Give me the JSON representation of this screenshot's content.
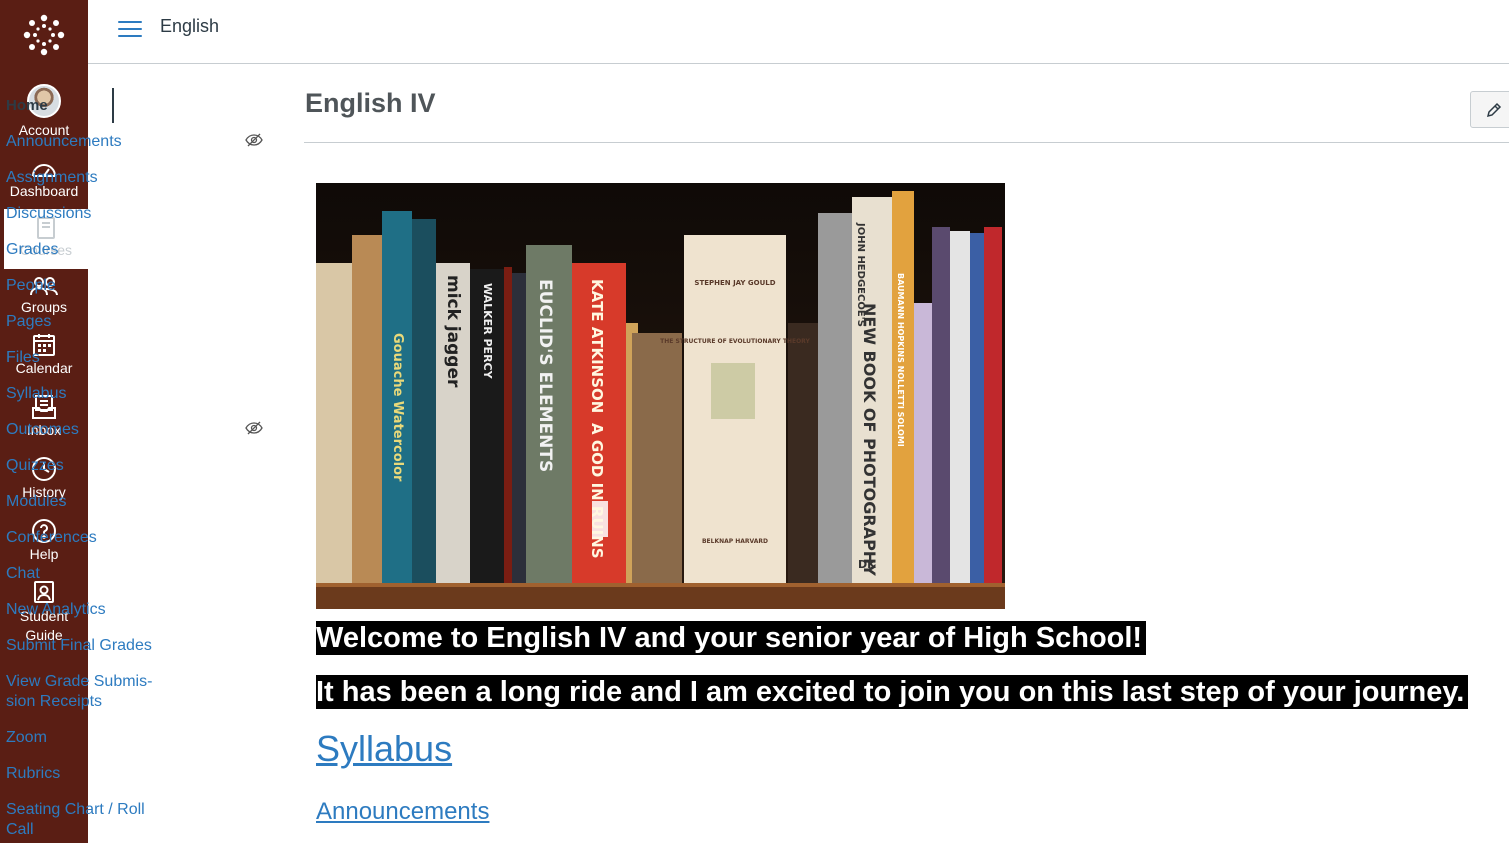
{
  "global_nav": {
    "items": [
      {
        "label": "Account",
        "icon": "avatar"
      },
      {
        "label": "Dashboard",
        "icon": "dashboard-icon"
      },
      {
        "label": "Courses",
        "icon": "courses-icon"
      },
      {
        "label": "Groups",
        "icon": "groups-icon"
      },
      {
        "label": "Calendar",
        "icon": "calendar-icon"
      },
      {
        "label": "Inbox",
        "icon": "inbox-icon"
      },
      {
        "label": "History",
        "icon": "history-icon"
      },
      {
        "label": "Help",
        "icon": "help-icon"
      },
      {
        "label_line1": "Student",
        "label_line2": "Guide",
        "icon": "student-guide-icon"
      }
    ],
    "brand_color": "#5a1e14"
  },
  "header": {
    "breadcrumb": "English"
  },
  "course_nav": {
    "items": [
      {
        "label": "Home",
        "active": true
      },
      {
        "label": "Announcements",
        "hidden_icon": true
      },
      {
        "label": "Assignments"
      },
      {
        "label": "Discussions"
      },
      {
        "label": "Grades"
      },
      {
        "label": "People"
      },
      {
        "label": "Pages"
      },
      {
        "label": "Files"
      },
      {
        "label": "Syllabus"
      },
      {
        "label": "Outcomes",
        "hidden_icon": true
      },
      {
        "label": "Quizzes"
      },
      {
        "label": "Modules"
      },
      {
        "label": "Conferences"
      },
      {
        "label": "Chat"
      },
      {
        "label": "New Analytics"
      },
      {
        "label": "Submit Final Grades"
      },
      {
        "label_line1": "View Grade Submis-",
        "label_line2": "sion Receipts"
      },
      {
        "label": "Zoom"
      },
      {
        "label": "Rubrics"
      },
      {
        "label_line1": "Seating Chart / Roll",
        "label_line2": "Call"
      }
    ],
    "link_color": "#2d7bc0"
  },
  "main": {
    "title": "English IV",
    "welcome_line1": "Welcome to English IV and your senior year of High School!",
    "welcome_line2": "It has been a long ride and I am excited to join you on this last step of your journey.",
    "syllabus_link": "Syllabus",
    "announcements_link": "Announcements"
  },
  "banner_spines": {
    "mick": "mick jagger",
    "walker": "WALKER PERCY",
    "euclid": "EUCLID'S ELEMENTS",
    "kate": "KATE ATKINSON",
    "god": "A GOD IN RUINS",
    "gould": "STEPHEN JAY GOULD",
    "structure": "THE STRUCTURE OF EVOLUTIONARY THEORY",
    "belknap": "BELKNAP HARVARD",
    "hedgecoe": "JOHN HEDGECOE'S",
    "photo": "NEW BOOK OF PHOTOGRAPHY",
    "dk": "DK",
    "watercolor": "Gouache Watercolor",
    "baumann": "BAUMANN HOPKINS NOLLETTI SOLOMI"
  }
}
